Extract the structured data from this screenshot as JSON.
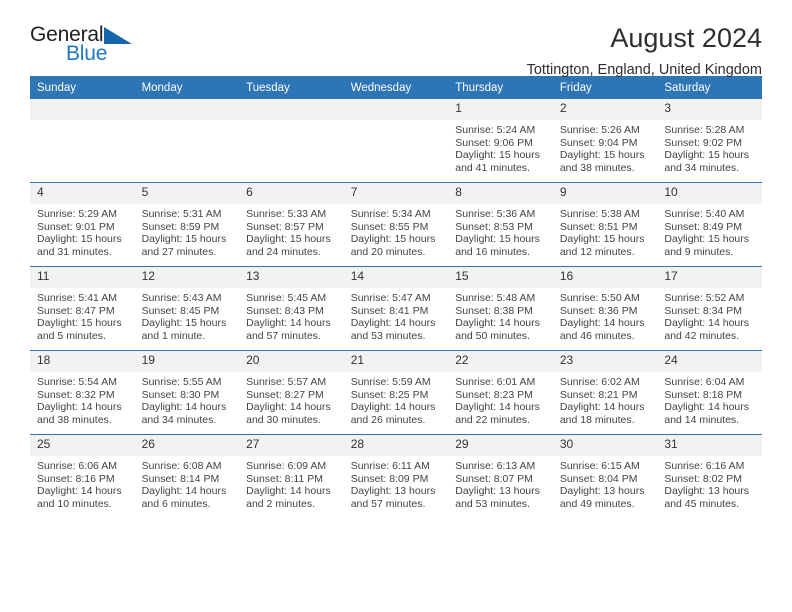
{
  "logo": {
    "line1": "General",
    "line2": "Blue",
    "triangle_color": "#1567ad",
    "blue_color": "#1f78c1"
  },
  "header": {
    "title": "August 2024",
    "subtitle": "Tottington, England, United Kingdom",
    "accent_color": "#2e75b6"
  },
  "weekdays": [
    "Sunday",
    "Monday",
    "Tuesday",
    "Wednesday",
    "Thursday",
    "Friday",
    "Saturday"
  ],
  "labels": {
    "sunrise_prefix": "Sunrise: ",
    "sunset_prefix": "Sunset: ",
    "daylight_prefix": "Daylight: "
  },
  "weeks": [
    [
      {
        "day": "",
        "empty": true
      },
      {
        "day": "",
        "empty": true
      },
      {
        "day": "",
        "empty": true
      },
      {
        "day": "",
        "empty": true
      },
      {
        "day": "1",
        "sunrise": "Sunrise: 5:24 AM",
        "sunset": "Sunset: 9:06 PM",
        "daylight1": "Daylight: 15 hours",
        "daylight2": "and 41 minutes."
      },
      {
        "day": "2",
        "sunrise": "Sunrise: 5:26 AM",
        "sunset": "Sunset: 9:04 PM",
        "daylight1": "Daylight: 15 hours",
        "daylight2": "and 38 minutes."
      },
      {
        "day": "3",
        "sunrise": "Sunrise: 5:28 AM",
        "sunset": "Sunset: 9:02 PM",
        "daylight1": "Daylight: 15 hours",
        "daylight2": "and 34 minutes."
      }
    ],
    [
      {
        "day": "4",
        "sunrise": "Sunrise: 5:29 AM",
        "sunset": "Sunset: 9:01 PM",
        "daylight1": "Daylight: 15 hours",
        "daylight2": "and 31 minutes."
      },
      {
        "day": "5",
        "sunrise": "Sunrise: 5:31 AM",
        "sunset": "Sunset: 8:59 PM",
        "daylight1": "Daylight: 15 hours",
        "daylight2": "and 27 minutes."
      },
      {
        "day": "6",
        "sunrise": "Sunrise: 5:33 AM",
        "sunset": "Sunset: 8:57 PM",
        "daylight1": "Daylight: 15 hours",
        "daylight2": "and 24 minutes."
      },
      {
        "day": "7",
        "sunrise": "Sunrise: 5:34 AM",
        "sunset": "Sunset: 8:55 PM",
        "daylight1": "Daylight: 15 hours",
        "daylight2": "and 20 minutes."
      },
      {
        "day": "8",
        "sunrise": "Sunrise: 5:36 AM",
        "sunset": "Sunset: 8:53 PM",
        "daylight1": "Daylight: 15 hours",
        "daylight2": "and 16 minutes."
      },
      {
        "day": "9",
        "sunrise": "Sunrise: 5:38 AM",
        "sunset": "Sunset: 8:51 PM",
        "daylight1": "Daylight: 15 hours",
        "daylight2": "and 12 minutes."
      },
      {
        "day": "10",
        "sunrise": "Sunrise: 5:40 AM",
        "sunset": "Sunset: 8:49 PM",
        "daylight1": "Daylight: 15 hours",
        "daylight2": "and 9 minutes."
      }
    ],
    [
      {
        "day": "11",
        "sunrise": "Sunrise: 5:41 AM",
        "sunset": "Sunset: 8:47 PM",
        "daylight1": "Daylight: 15 hours",
        "daylight2": "and 5 minutes."
      },
      {
        "day": "12",
        "sunrise": "Sunrise: 5:43 AM",
        "sunset": "Sunset: 8:45 PM",
        "daylight1": "Daylight: 15 hours",
        "daylight2": "and 1 minute."
      },
      {
        "day": "13",
        "sunrise": "Sunrise: 5:45 AM",
        "sunset": "Sunset: 8:43 PM",
        "daylight1": "Daylight: 14 hours",
        "daylight2": "and 57 minutes."
      },
      {
        "day": "14",
        "sunrise": "Sunrise: 5:47 AM",
        "sunset": "Sunset: 8:41 PM",
        "daylight1": "Daylight: 14 hours",
        "daylight2": "and 53 minutes."
      },
      {
        "day": "15",
        "sunrise": "Sunrise: 5:48 AM",
        "sunset": "Sunset: 8:38 PM",
        "daylight1": "Daylight: 14 hours",
        "daylight2": "and 50 minutes."
      },
      {
        "day": "16",
        "sunrise": "Sunrise: 5:50 AM",
        "sunset": "Sunset: 8:36 PM",
        "daylight1": "Daylight: 14 hours",
        "daylight2": "and 46 minutes."
      },
      {
        "day": "17",
        "sunrise": "Sunrise: 5:52 AM",
        "sunset": "Sunset: 8:34 PM",
        "daylight1": "Daylight: 14 hours",
        "daylight2": "and 42 minutes."
      }
    ],
    [
      {
        "day": "18",
        "sunrise": "Sunrise: 5:54 AM",
        "sunset": "Sunset: 8:32 PM",
        "daylight1": "Daylight: 14 hours",
        "daylight2": "and 38 minutes."
      },
      {
        "day": "19",
        "sunrise": "Sunrise: 5:55 AM",
        "sunset": "Sunset: 8:30 PM",
        "daylight1": "Daylight: 14 hours",
        "daylight2": "and 34 minutes."
      },
      {
        "day": "20",
        "sunrise": "Sunrise: 5:57 AM",
        "sunset": "Sunset: 8:27 PM",
        "daylight1": "Daylight: 14 hours",
        "daylight2": "and 30 minutes."
      },
      {
        "day": "21",
        "sunrise": "Sunrise: 5:59 AM",
        "sunset": "Sunset: 8:25 PM",
        "daylight1": "Daylight: 14 hours",
        "daylight2": "and 26 minutes."
      },
      {
        "day": "22",
        "sunrise": "Sunrise: 6:01 AM",
        "sunset": "Sunset: 8:23 PM",
        "daylight1": "Daylight: 14 hours",
        "daylight2": "and 22 minutes."
      },
      {
        "day": "23",
        "sunrise": "Sunrise: 6:02 AM",
        "sunset": "Sunset: 8:21 PM",
        "daylight1": "Daylight: 14 hours",
        "daylight2": "and 18 minutes."
      },
      {
        "day": "24",
        "sunrise": "Sunrise: 6:04 AM",
        "sunset": "Sunset: 8:18 PM",
        "daylight1": "Daylight: 14 hours",
        "daylight2": "and 14 minutes."
      }
    ],
    [
      {
        "day": "25",
        "sunrise": "Sunrise: 6:06 AM",
        "sunset": "Sunset: 8:16 PM",
        "daylight1": "Daylight: 14 hours",
        "daylight2": "and 10 minutes."
      },
      {
        "day": "26",
        "sunrise": "Sunrise: 6:08 AM",
        "sunset": "Sunset: 8:14 PM",
        "daylight1": "Daylight: 14 hours",
        "daylight2": "and 6 minutes."
      },
      {
        "day": "27",
        "sunrise": "Sunrise: 6:09 AM",
        "sunset": "Sunset: 8:11 PM",
        "daylight1": "Daylight: 14 hours",
        "daylight2": "and 2 minutes."
      },
      {
        "day": "28",
        "sunrise": "Sunrise: 6:11 AM",
        "sunset": "Sunset: 8:09 PM",
        "daylight1": "Daylight: 13 hours",
        "daylight2": "and 57 minutes."
      },
      {
        "day": "29",
        "sunrise": "Sunrise: 6:13 AM",
        "sunset": "Sunset: 8:07 PM",
        "daylight1": "Daylight: 13 hours",
        "daylight2": "and 53 minutes."
      },
      {
        "day": "30",
        "sunrise": "Sunrise: 6:15 AM",
        "sunset": "Sunset: 8:04 PM",
        "daylight1": "Daylight: 13 hours",
        "daylight2": "and 49 minutes."
      },
      {
        "day": "31",
        "sunrise": "Sunrise: 6:16 AM",
        "sunset": "Sunset: 8:02 PM",
        "daylight1": "Daylight: 13 hours",
        "daylight2": "and 45 minutes."
      }
    ]
  ]
}
